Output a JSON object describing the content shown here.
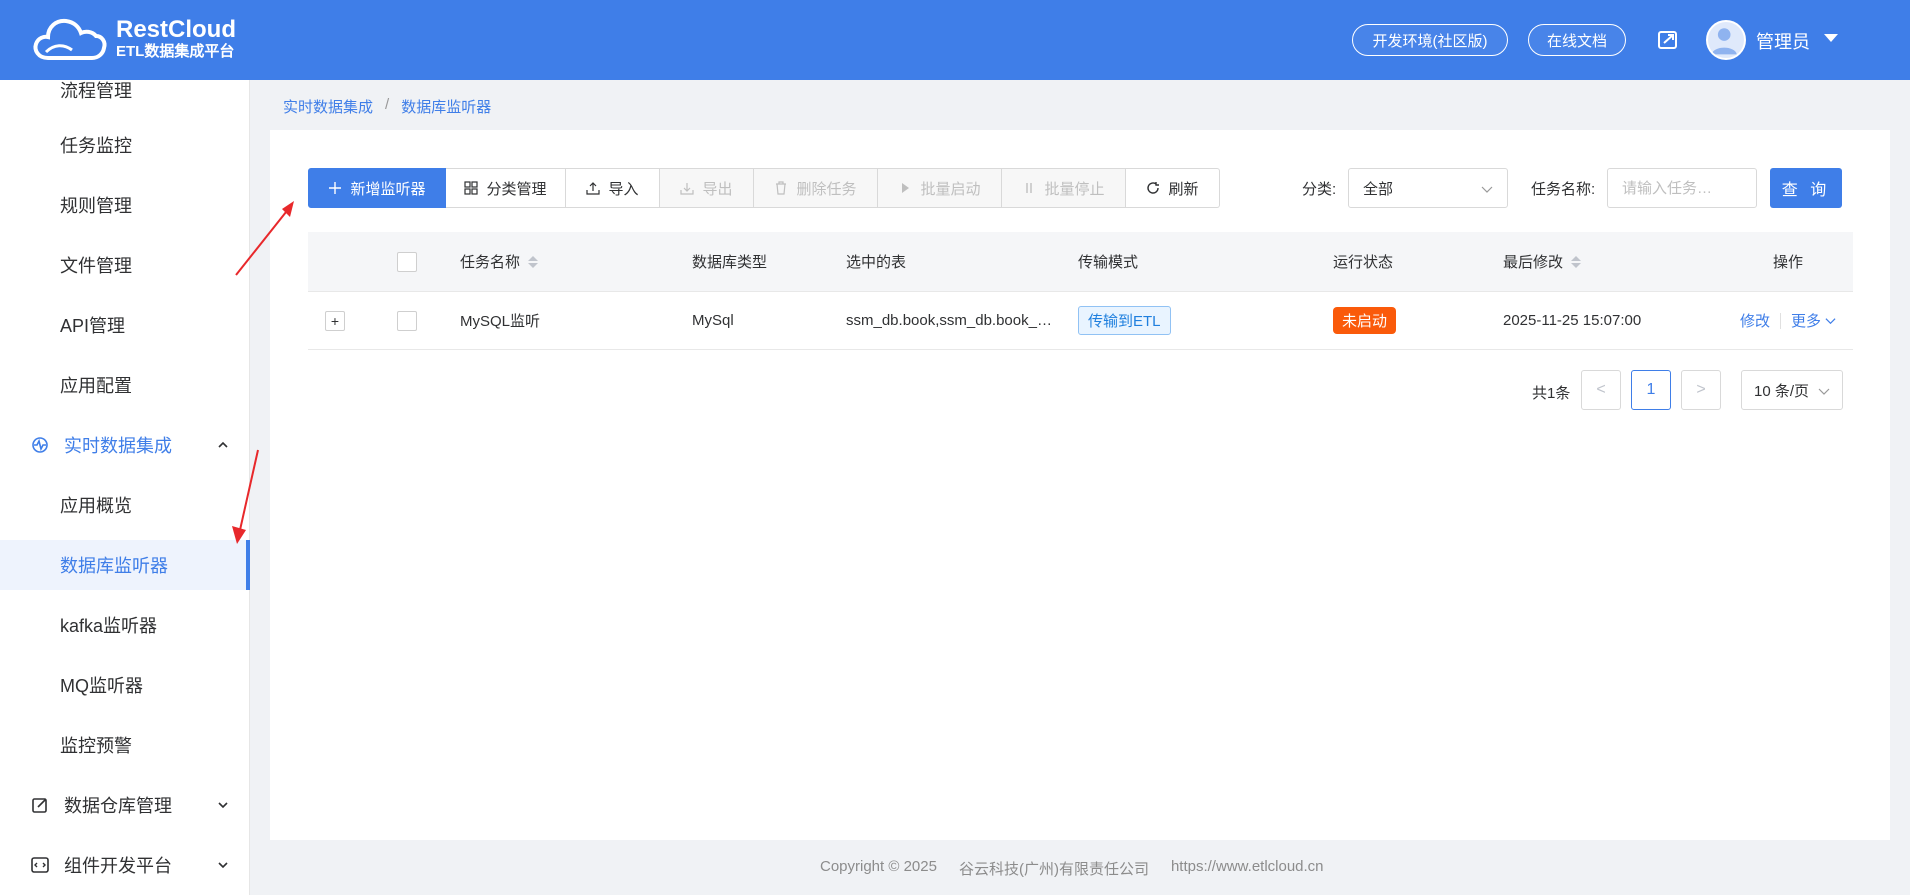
{
  "header": {
    "logo_title": "RestCloud",
    "logo_subtitle": "ETL数据集成平台",
    "env_button": "开发环境(社区版)",
    "docs_button": "在线文档",
    "user_name": "管理员"
  },
  "sidebar": {
    "items": [
      {
        "label": "流程管理"
      },
      {
        "label": "任务监控"
      },
      {
        "label": "规则管理"
      },
      {
        "label": "文件管理"
      },
      {
        "label": "API管理"
      },
      {
        "label": "应用配置"
      },
      {
        "label": "实时数据集成"
      },
      {
        "label": "应用概览"
      },
      {
        "label": "数据库监听器"
      },
      {
        "label": "kafka监听器"
      },
      {
        "label": "MQ监听器"
      },
      {
        "label": "监控预警"
      },
      {
        "label": "数据仓库管理"
      },
      {
        "label": "组件开发平台"
      }
    ]
  },
  "breadcrumb": {
    "level1": "实时数据集成",
    "separator": "/",
    "level2": "数据库监听器"
  },
  "toolbar": {
    "add": "新增监听器",
    "category": "分类管理",
    "import": "导入",
    "export": "导出",
    "delete": "删除任务",
    "batch_start": "批量启动",
    "batch_stop": "批量停止",
    "refresh": "刷新"
  },
  "filters": {
    "category_label": "分类:",
    "category_value": "全部",
    "task_name_label": "任务名称:",
    "task_name_placeholder": "请输入任务…",
    "query": "查 询"
  },
  "table": {
    "columns": [
      "任务名称",
      "数据库类型",
      "选中的表",
      "传输模式",
      "运行状态",
      "最后修改",
      "操作"
    ],
    "rows": [
      {
        "expand": "+",
        "name": "MySQL监听",
        "db_type": "MySql",
        "tables": "ssm_db.book,ssm_db.book_back",
        "mode": "传输到ETL",
        "status": "未启动",
        "modified": "2025-11-25 15:07:00",
        "edit": "修改",
        "more": "更多"
      }
    ]
  },
  "pagination": {
    "total": "共1条",
    "current_page": "1",
    "prev": "<",
    "next": ">",
    "page_size": "10 条/页"
  },
  "footer": {
    "copyright": "Copyright © 2025",
    "company": "谷云科技(广州)有限责任公司",
    "url": "https://www.etlcloud.cn"
  },
  "colors": {
    "primary": "#3f7ee8",
    "status_stopped": "#fa5a0a",
    "annotation_arrow": "#e8282b"
  }
}
